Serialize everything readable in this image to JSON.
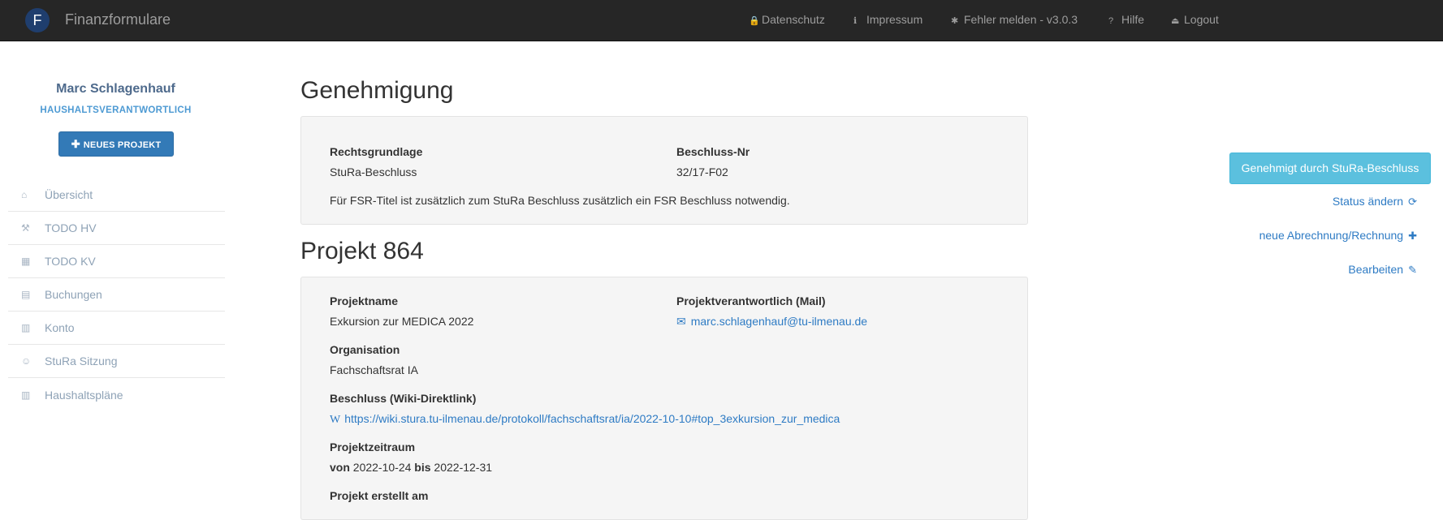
{
  "navbar": {
    "logo_letter": "F",
    "brand": "Finanzformulare",
    "items": [
      {
        "label": "Datenschutz",
        "icon": "lock-icon",
        "glyph": "🔒"
      },
      {
        "label": "Impressum",
        "icon": "info-icon",
        "glyph": "ℹ"
      },
      {
        "label": "Fehler melden - v3.0.3",
        "icon": "bug-icon",
        "glyph": "✱"
      },
      {
        "label": "Hilfe",
        "icon": "question-icon",
        "glyph": "?"
      },
      {
        "label": "Logout",
        "icon": "logout-icon",
        "glyph": "⏏"
      }
    ]
  },
  "sidebar": {
    "user_name": "Marc Schlagenhauf",
    "user_role": "HAUSHALTSVERANTWORTLICH",
    "new_project_label": "NEUES PROJEKT",
    "items": [
      {
        "label": "Übersicht",
        "icon": "home-icon",
        "glyph": "⌂"
      },
      {
        "label": "TODO HV",
        "icon": "gavel-icon",
        "glyph": "⚒"
      },
      {
        "label": "TODO KV",
        "icon": "calculator-icon",
        "glyph": "▦"
      },
      {
        "label": "Buchungen",
        "icon": "book-icon",
        "glyph": "▤"
      },
      {
        "label": "Konto",
        "icon": "bar-chart-icon",
        "glyph": "▥"
      },
      {
        "label": "StuRa Sitzung",
        "icon": "users-icon",
        "glyph": "☺"
      },
      {
        "label": "Haushaltspläne",
        "icon": "bar-chart-icon",
        "glyph": "▥"
      }
    ]
  },
  "approval": {
    "title": "Genehmigung",
    "legal_basis_label": "Rechtsgrundlage",
    "legal_basis": "StuRa-Beschluss",
    "resolution_nr_label": "Beschluss-Nr",
    "resolution_nr": "32/17-F02",
    "note": "Für FSR-Titel ist zusätzlich zum StuRa Beschluss zusätzlich ein FSR Beschluss notwendig."
  },
  "project": {
    "title": "Projekt 864",
    "name_label": "Projektname",
    "name": "Exkursion zur MEDICA 2022",
    "responsible_label": "Projektverantwortlich (Mail)",
    "responsible_mail": "marc.schlagenhauf@tu-ilmenau.de",
    "organisation_label": "Organisation",
    "organisation": "Fachschaftsrat IA",
    "resolution_link_label": "Beschluss (Wiki-Direktlink)",
    "resolution_link": "https://wiki.stura.tu-ilmenau.de/protokoll/fachschaftsrat/ia/2022-10-10#top_3exkursion_zur_medica",
    "period_label": "Projektzeitraum",
    "period_from_word": "von",
    "period_from": "2022-10-24",
    "period_to_word": "bis",
    "period_to": "2022-12-31",
    "created_label": "Projekt erstellt am"
  },
  "actions": {
    "status_button": "Genehmigt durch StuRa-Beschluss",
    "change_status": "Status ändern",
    "new_invoice": "neue Abrechnung/Rechnung",
    "edit": "Bearbeiten"
  },
  "colors": {
    "navbar_bg": "#262626",
    "primary": "#337ab7",
    "info": "#5bc0de",
    "link": "#2e7bc4"
  }
}
